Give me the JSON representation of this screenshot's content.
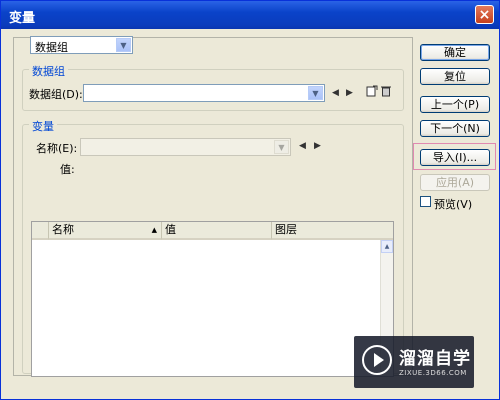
{
  "window": {
    "title": "变量",
    "close_label": "×"
  },
  "top_combo": {
    "value": "数据组"
  },
  "dataset_group": {
    "legend": "数据组",
    "label": "数据组(D):",
    "value": ""
  },
  "variable_group": {
    "legend": "变量",
    "name_label": "名称(E):",
    "name_value": "",
    "value_label": "值:"
  },
  "table": {
    "columns": [
      {
        "label": "名称",
        "sort": "▲"
      },
      {
        "label": "值"
      },
      {
        "label": "图层"
      }
    ],
    "rows": []
  },
  "buttons": {
    "ok": "确定",
    "reset": "复位",
    "prev": "上一个(P)",
    "next": "下一个(N)",
    "import": "导入(I)...",
    "apply": "应用(A)"
  },
  "preview": {
    "label": "预览(V)",
    "checked": false
  },
  "watermark": {
    "name": "溜溜自学",
    "url": "ZIXUE.3D66.COM"
  }
}
